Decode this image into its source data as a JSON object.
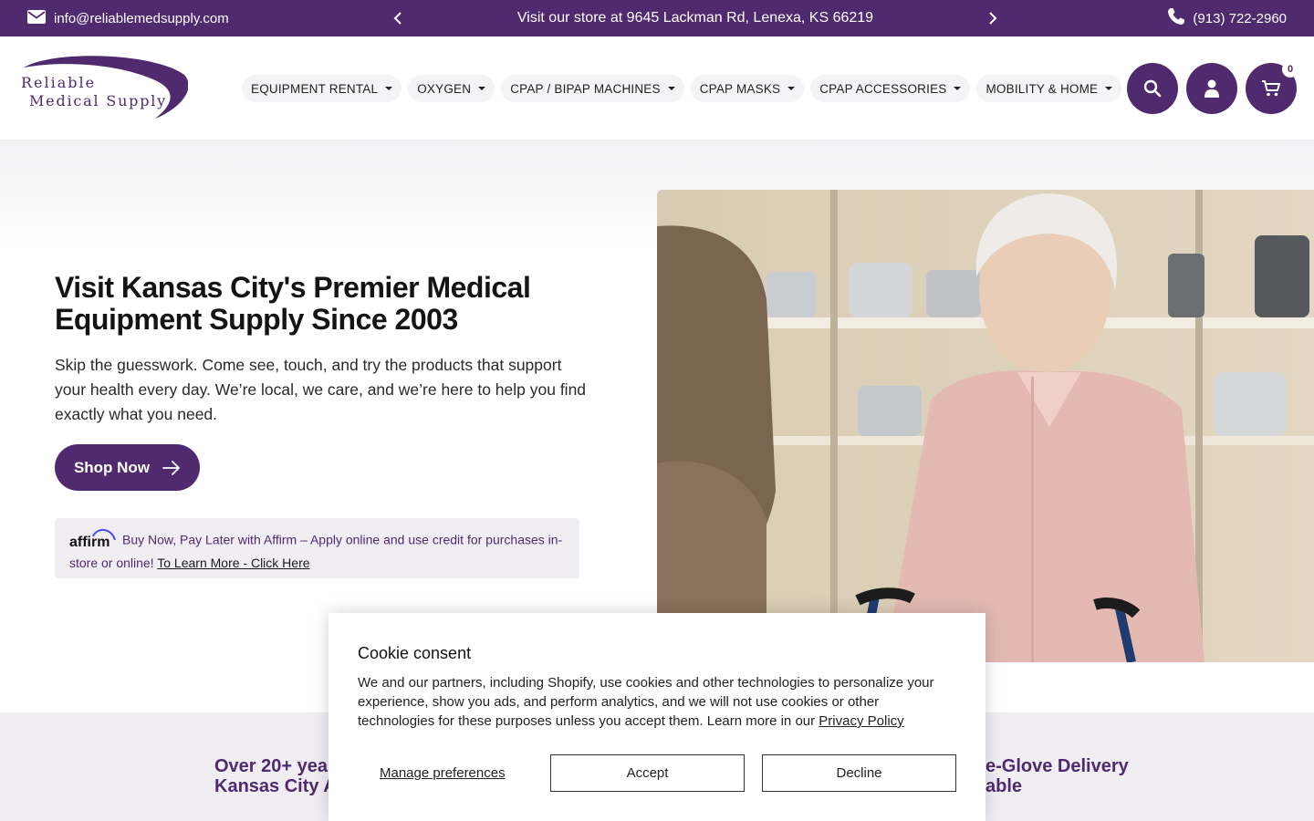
{
  "topbar": {
    "email": "info@reliablemedsupply.com",
    "announcement": "Visit our store at 9645 Lackman Rd, Lenexa, KS 66219",
    "phone": "(913) 722-2960"
  },
  "header": {
    "logo_line1": "Reliable",
    "logo_line2": "Medical Supply",
    "nav": [
      {
        "label": "EQUIPMENT RENTAL"
      },
      {
        "label": "OXYGEN"
      },
      {
        "label": "CPAP / BIPAP MACHINES"
      },
      {
        "label": "CPAP MASKS"
      },
      {
        "label": "CPAP ACCESSORIES"
      },
      {
        "label": "MOBILITY & HOME"
      }
    ],
    "cart_count": "0"
  },
  "hero": {
    "title": "Visit Kansas City's Premier Medical Equipment Supply Since 2003",
    "text": "Skip the guesswork. Come see, touch, and try the products that support your health every day. We’re local, we care, and we’re here to help you find exactly what you need.",
    "cta": "Shop Now",
    "affirm_brand": "affirm",
    "affirm_text": "Buy Now, Pay Later with Affirm – Apply online and use credit for purchases in-store or online! ",
    "affirm_link": "To Learn More - Click Here"
  },
  "features": {
    "left_line1": "Over 20+ yea",
    "left_line2": "Kansas City A",
    "right_line1": "e-Glove Delivery",
    "right_line2": "able"
  },
  "cookie": {
    "title": "Cookie consent",
    "body": "We and our partners, including Shopify, use cookies and other technologies to personalize your experience, show you ads, and perform analytics, and we will not use cookies or other technologies for these purposes unless you accept them. Learn more in our ",
    "privacy_link": "Privacy Policy",
    "manage": "Manage preferences",
    "accept": "Accept",
    "decline": "Decline"
  },
  "colors": {
    "brand_purple": "#4f2a6f",
    "light_lavender": "#f1eef3"
  }
}
